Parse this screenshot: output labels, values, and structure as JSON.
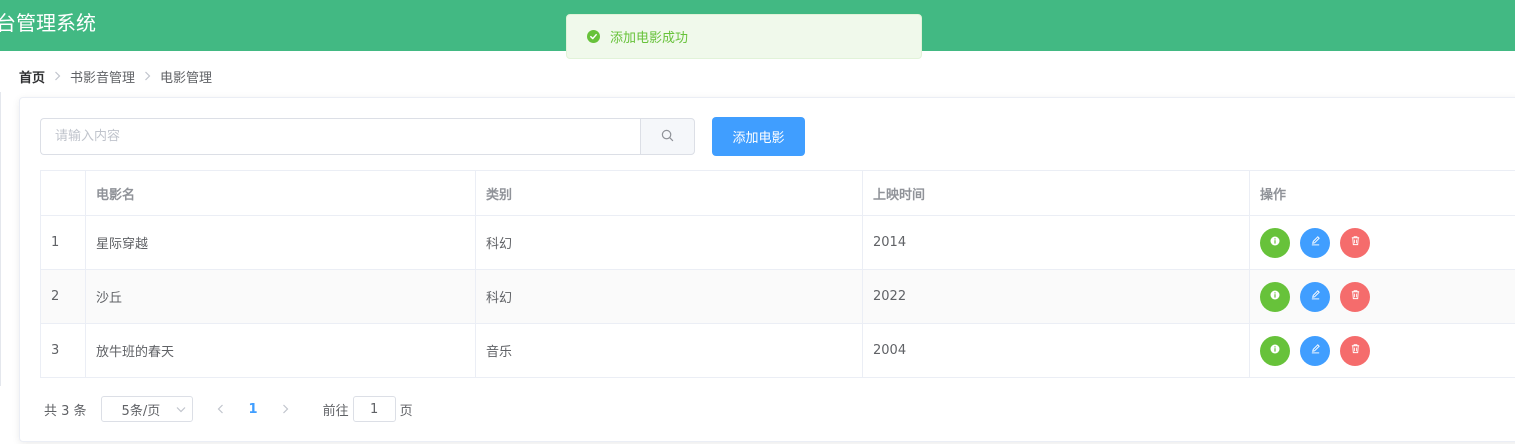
{
  "header": {
    "title": "台管理系统",
    "color": "#42b983"
  },
  "toast": {
    "message": "添加电影成功",
    "icon": "check-circle-icon",
    "color": "#67c23a"
  },
  "breadcrumb": {
    "items": [
      "首页",
      "书影音管理",
      "电影管理"
    ]
  },
  "search": {
    "placeholder": "请输入内容",
    "value": "",
    "button_icon": "search-icon"
  },
  "toolbar": {
    "add_label": "添加电影"
  },
  "table": {
    "columns": [
      "",
      "电影名",
      "类别",
      "上映时间",
      "操作"
    ],
    "rows": [
      {
        "index": "1",
        "name": "星际穿越",
        "category": "科幻",
        "year": "2014"
      },
      {
        "index": "2",
        "name": "沙丘",
        "category": "科幻",
        "year": "2022"
      },
      {
        "index": "3",
        "name": "放牛班的春天",
        "category": "音乐",
        "year": "2004"
      }
    ],
    "actions": [
      {
        "name": "info",
        "icon": "info-icon",
        "color": "#67c23a"
      },
      {
        "name": "edit",
        "icon": "edit-icon",
        "color": "#409eff"
      },
      {
        "name": "delete",
        "icon": "delete-icon",
        "color": "#f56c6c"
      }
    ]
  },
  "pagination": {
    "total_text": "共 3 条",
    "page_size": "5条/页",
    "current_page": "1",
    "goto_label": "前往",
    "goto_value": "1",
    "goto_suffix": "页"
  },
  "colors": {
    "primary": "#409eff",
    "success": "#67c23a",
    "danger": "#f56c6c"
  }
}
